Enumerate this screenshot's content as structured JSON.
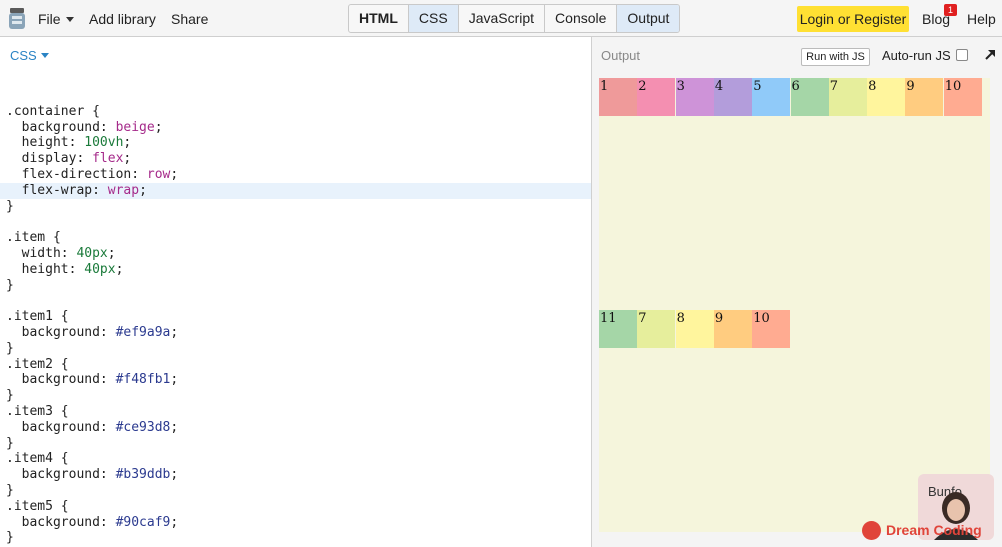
{
  "topbar": {
    "menu": {
      "file": "File",
      "add_library": "Add library",
      "share": "Share"
    },
    "tabs": [
      "HTML",
      "CSS",
      "JavaScript",
      "Console",
      "Output"
    ],
    "login": "Login or Register",
    "blog": "Blog",
    "blog_badge": "1",
    "help": "Help"
  },
  "editor": {
    "label": "CSS",
    "code_lines": [
      "",
      ".container {",
      "  background: beige;",
      "  height: 100vh;",
      "  display: flex;",
      "  flex-direction: row;",
      "  flex-wrap: wrap;",
      "}",
      "",
      ".item {",
      "  width: 40px;",
      "  height: 40px;",
      "}",
      "",
      ".item1 {",
      "  background: #ef9a9a;",
      "}",
      ".item2 {",
      "  background: #f48fb1;",
      "}",
      ".item3 {",
      "  background: #ce93d8;",
      "}",
      ".item4 {",
      "  background: #b39ddb;",
      "}",
      ".item5 {",
      "  background: #90caf9;",
      "}"
    ]
  },
  "output": {
    "label": "Output",
    "run_with_js": "Run with JS",
    "auto_run": "Auto-run JS",
    "row1": [
      {
        "label": "1",
        "color": "#ef9a9a"
      },
      {
        "label": "2",
        "color": "#f48fb1"
      },
      {
        "label": "3",
        "color": "#ce93d8"
      },
      {
        "label": "4",
        "color": "#b39ddb"
      },
      {
        "label": "5",
        "color": "#90caf9"
      },
      {
        "label": "6",
        "color": "#a5d6a7"
      },
      {
        "label": "7",
        "color": "#e6ee9c"
      },
      {
        "label": "8",
        "color": "#fff59d"
      },
      {
        "label": "9",
        "color": "#ffcc80"
      },
      {
        "label": "10",
        "color": "#ffab91"
      }
    ],
    "row2": [
      {
        "label": "11",
        "color": "#a5d6a7"
      },
      {
        "label": "7",
        "color": "#e6ee9c"
      },
      {
        "label": "8",
        "color": "#fff59d"
      },
      {
        "label": "9",
        "color": "#ffcc80"
      },
      {
        "label": "10",
        "color": "#ffab91"
      }
    ]
  },
  "watermark": {
    "webcam_text": "Bunfo",
    "brand": "Dream Coding"
  },
  "colors": {
    "accent": "#2a83c4",
    "login_bg": "#ffe033",
    "stage_bg": "#f5f5dc",
    "brand": "#e0443a"
  }
}
